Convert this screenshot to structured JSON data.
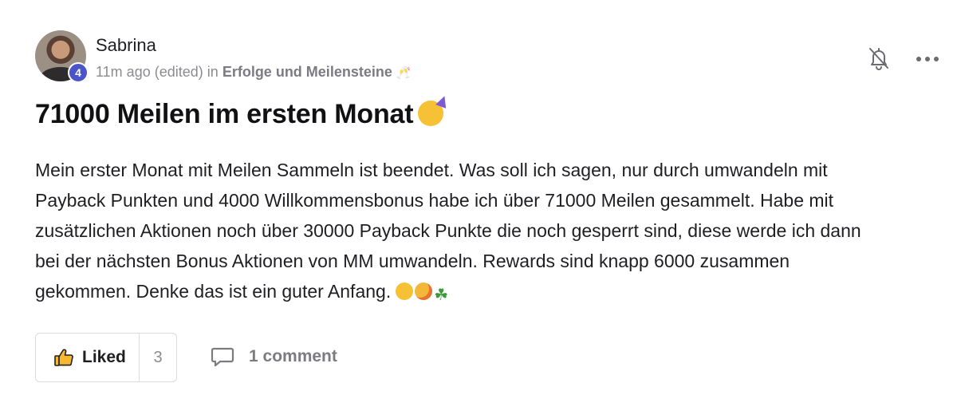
{
  "post": {
    "author": {
      "name": "Sabrina",
      "level_badge": "4"
    },
    "meta": {
      "time": "11m ago",
      "edited": "(edited)",
      "in_label": "in",
      "space": "Erfolge und Meilensteine",
      "space_emoji": "🥂"
    },
    "title": "71000 Meilen im ersten Monat",
    "title_emoji": "partying-face",
    "body_lines": [
      "Mein erster Monat mit Meilen Sammeln ist beendet. Was soll ich sagen, nur durch umwandeln mit",
      "Payback Punkten und 4000 Willkommensbonus habe ich über 71000 Meilen gesammelt. Habe mit",
      "zusätzlichen Aktionen noch über 30000 Payback Punkte die noch gesperrt sind, diese werde ich dann",
      "bei der nächsten Bonus Aktionen von MM umwandeln. Rewards sind knapp 6000 zusammen",
      "gekommen. Denke das ist ein guter Anfang."
    ],
    "body_end_emojis": [
      "smiling-face",
      "partying-face",
      "four-leaf-clover"
    ],
    "actions": {
      "like_label": "Liked",
      "like_count": "3",
      "comment_label": "1 comment"
    }
  },
  "icons": {
    "bell": "bell-off-icon",
    "more": "more-horizontal-icon",
    "like": "thumbs-up-icon",
    "comment": "comment-icon"
  },
  "colors": {
    "badge": "#4b55c9",
    "text": "#1f1f23",
    "muted": "#8b8b92",
    "border": "#dcdce0"
  }
}
